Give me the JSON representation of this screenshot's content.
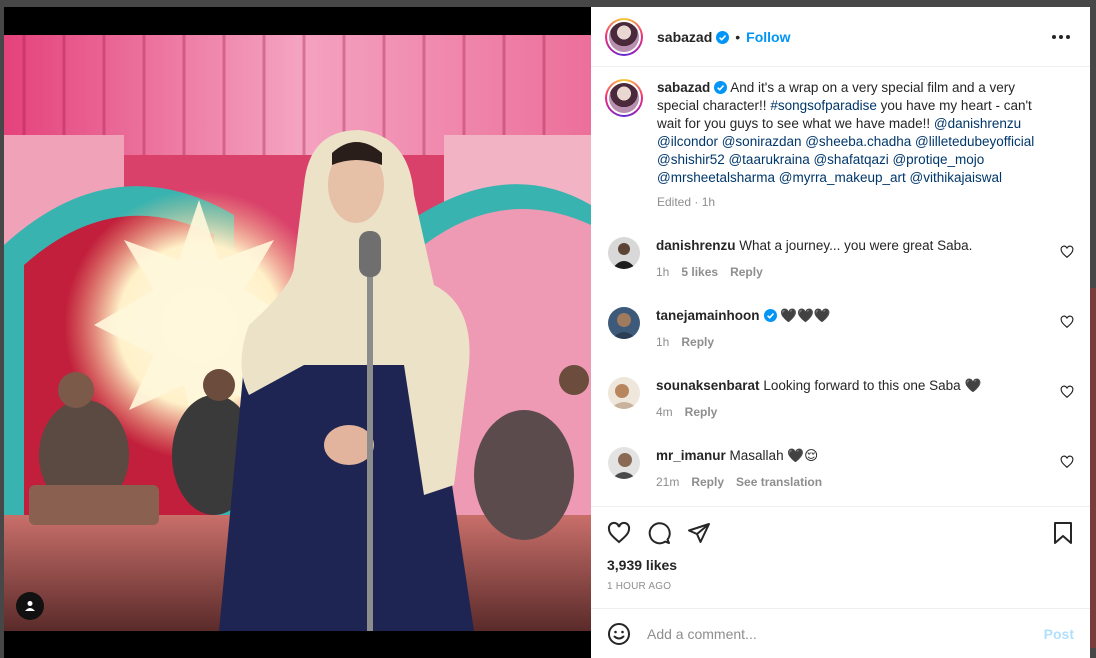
{
  "post": {
    "username": "sabazad",
    "follow_label": "Follow",
    "separator": "•",
    "caption": {
      "username": "sabazad",
      "text_1": " And it's a wrap on a very special film and a very special character!! ",
      "hashtag": "#songsofparadise",
      "text_2": " you have my heart - can't wait for you guys to see what we have made!! ",
      "mentions": "@danishrenzu @ilcondor @sonirazdan @sheeba.chadha @lilletedubeyofficial @shishir52 @taarukraina @shafatqazi @protiqe_mojo @mrsheetalsharma @myrra_makeup_art @vithikajaiswal",
      "edited_label": "Edited · 1h"
    },
    "comments": [
      {
        "username": "danishrenzu",
        "text": "What a journey... you were great Saba.",
        "time": "1h",
        "likes": "5 likes",
        "reply": "Reply",
        "extra": ""
      },
      {
        "username": "tanejamainhoon",
        "text": "🖤🖤🖤",
        "time": "1h",
        "likes": "",
        "reply": "Reply",
        "extra": ""
      },
      {
        "username": "sounaksenbarat",
        "text": "Looking forward to this one Saba 🖤",
        "time": "4m",
        "likes": "",
        "reply": "Reply",
        "extra": ""
      },
      {
        "username": "mr_imanur",
        "text": "Masallah 🖤😌",
        "time": "21m",
        "likes": "",
        "reply": "Reply",
        "extra": "See translation"
      }
    ],
    "likes_count": "3,939 likes",
    "posted_ago": "1 HOUR AGO",
    "add_comment_placeholder": "Add a comment...",
    "post_label": "Post"
  },
  "icons": {
    "heart": "heart-icon",
    "comment": "comment-icon",
    "share": "share-icon",
    "save": "bookmark-icon",
    "emoji": "emoji-icon",
    "tag": "user-tag-icon",
    "more": "more-options-icon",
    "verified": "verified-badge-icon"
  },
  "colors": {
    "accent": "#0095f6",
    "link": "#00376b",
    "muted": "#8e8e8e",
    "post_disabled": "#b2dffc"
  }
}
